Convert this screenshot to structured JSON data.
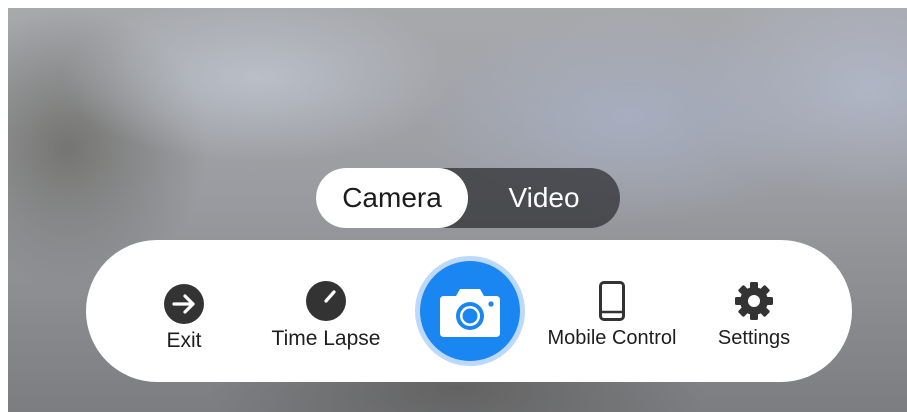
{
  "mode_toggle": {
    "camera_label": "Camera",
    "video_label": "Video",
    "selected": "Camera"
  },
  "controls": {
    "exit": {
      "label": "Exit",
      "icon": "arrow-right-circle-icon"
    },
    "time_lapse": {
      "label": "Time Lapse",
      "icon": "clock-icon"
    },
    "shutter": {
      "icon": "camera-icon"
    },
    "mobile_control": {
      "label": "Mobile Control",
      "icon": "smartphone-icon"
    },
    "settings": {
      "label": "Settings",
      "icon": "gear-icon"
    }
  },
  "colors": {
    "accent": "#1a86f2",
    "accent_ring": "#bcd9fb",
    "icon_dark": "#333333",
    "bar_background": "#ffffff"
  }
}
